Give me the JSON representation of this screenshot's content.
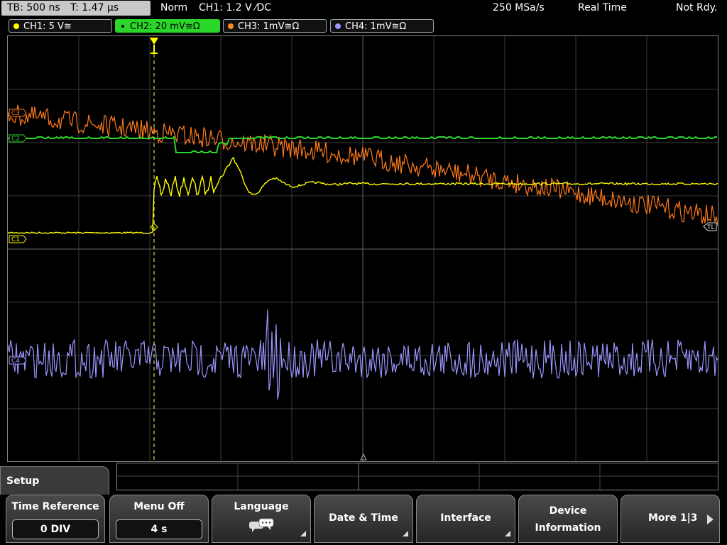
{
  "topbar": {
    "timebase": "TB: 500 ns",
    "trigger_time": "T: 1.47 µs",
    "mode": "Norm",
    "trigger_info": "CH1: 1.2 V ⁄DC",
    "sample_rate": "250 MSa/s",
    "acquisition": "Real Time",
    "status": "Not Rdy."
  },
  "channels": [
    {
      "label": "CH1: 5 V≅",
      "color": "#ffff00",
      "active": false
    },
    {
      "label": "CH2: 20 mV≅Ω",
      "color": "#00ff00",
      "active": true
    },
    {
      "label": "CH3: 1mV≅Ω",
      "color": "#ff8c1a",
      "active": false
    },
    {
      "label": "CH4: 1mV≅Ω",
      "color": "#9b96ff",
      "active": false
    }
  ],
  "scope": {
    "channel_markers": [
      "C1",
      "C2",
      "C3",
      "C4"
    ],
    "trigger_level_marker": "TL",
    "trigger_position_marker": "T"
  },
  "menu": {
    "title": "Setup",
    "softkeys": [
      {
        "label": "Time Reference",
        "value": "0 DIV"
      },
      {
        "label": "Menu Off",
        "value": "4 s"
      },
      {
        "label": "Language",
        "icon": "speech-bubbles-icon"
      },
      {
        "label": "Date & Time"
      },
      {
        "label": "Interface"
      },
      {
        "label_line1": "Device",
        "label_line2": "Information"
      },
      {
        "label": "More 1|3"
      }
    ]
  },
  "colors": {
    "ch1": "#ffff00",
    "ch2": "#2bd62b",
    "ch3": "#ff7a1a",
    "ch4": "#9b96ff",
    "grid": "#555555"
  }
}
